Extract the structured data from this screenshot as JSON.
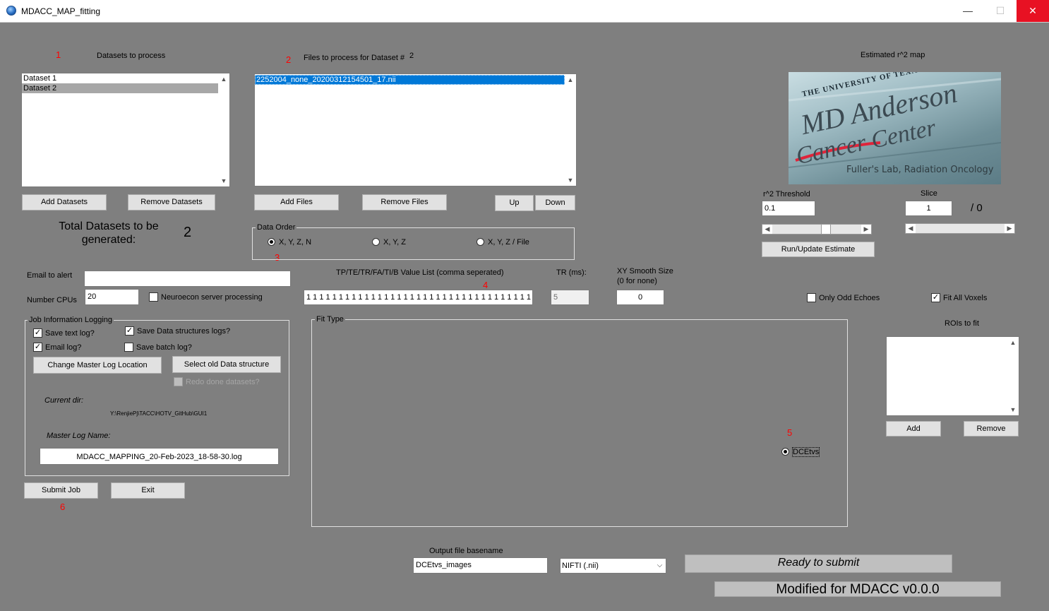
{
  "window": {
    "title": "MDACC_MAP_fitting",
    "minimize": "—",
    "maximize": "☐",
    "close": "✕"
  },
  "annotations": [
    "1",
    "2",
    "3",
    "4",
    "5",
    "6"
  ],
  "datasets": {
    "label": "Datasets to process",
    "items": [
      "Dataset  1",
      "Dataset  2"
    ],
    "add_button": "Add Datasets",
    "remove_button": "Remove Datasets",
    "total_label": "Total Datasets to be generated:",
    "total_value": "2"
  },
  "files": {
    "label": "Files to process for Dataset #",
    "dataset_number": "2",
    "items": [
      "2252004_none_20200312154501_17.nii"
    ],
    "add_button": "Add Files",
    "remove_button": "Remove Files",
    "up_button": "Up",
    "down_button": "Down"
  },
  "data_order": {
    "title": "Data Order",
    "options": [
      "X, Y, Z, N",
      "X, Y, Z",
      "X, Y, Z / File"
    ],
    "selected": "X, Y, Z, N"
  },
  "estimate": {
    "title": "Estimated r^2 map",
    "logo_line1": "THE UNIVERSITY OF TEXAS",
    "logo_line2": "MD Anderson",
    "logo_line3": "Cancer Center",
    "logo_caption": "Fuller's Lab, Radiation Oncology",
    "threshold_label": "r^2 Threshold",
    "threshold_value": "0.1",
    "slice_label": "Slice",
    "slice_value": "1",
    "slice_total": "/ 0",
    "run_button": "Run/Update Estimate",
    "threshold_slider_fraction": 0.62,
    "slice_slider_fraction": 0.0
  },
  "settings": {
    "email_label": "Email to alert",
    "email_value": "",
    "cpus_label": "Number CPUs",
    "cpus_value": "20",
    "neuroecon_label": "Neuroecon server processing",
    "neuroecon_checked": false,
    "value_list_label": "TP/TE/TR/FA/TI/B Value List (comma seperated)",
    "value_list_value": "1 1 1 1 1 1 1 1 1 1 1 1 1 1 1 1 1 1 1 1 1 1 1 1 1 1 1 1 1 1 1 1 1 1 1 1 1 1 1 1 1 1",
    "tr_label": "TR (ms):",
    "tr_value": "5",
    "smooth_label_1": "XY Smooth Size",
    "smooth_label_2": "(0 for none)",
    "smooth_value": "0",
    "odd_echoes_label": "Only Odd Echoes",
    "odd_echoes_checked": false,
    "fit_all_label": "Fit All Voxels",
    "fit_all_checked": true
  },
  "logging": {
    "title": "Job Information Logging",
    "save_text_log": "Save text log?",
    "email_log": "Email log?",
    "save_data_logs": "Save Data structures logs?",
    "save_batch_log": "Save batch log?",
    "change_master_button": "Change Master Log Location",
    "select_old_button": "Select old Data structure",
    "redo_label": "Redo done datasets?",
    "current_dir_label": "Current dir:",
    "current_dir_value": "Y:\\RenjiePj\\TACC\\HOTV_GitHub\\GUI1",
    "master_log_label": "Master Log Name:",
    "master_log_value": "MDACC_MAPPING_20-Feb-2023_18-58-30.log",
    "checks": {
      "save_text": true,
      "email": true,
      "save_data": true,
      "save_batch": false,
      "redo": false
    }
  },
  "fit_type": {
    "title": "Fit Type",
    "options": [
      "DCEtvs"
    ],
    "selected": "DCEtvs"
  },
  "rois": {
    "label": "ROIs to fit",
    "items": [],
    "add_button": "Add",
    "remove_button": "Remove"
  },
  "actions": {
    "submit_button": "Submit Job",
    "exit_button": "Exit"
  },
  "output": {
    "basename_label": "Output file basename",
    "basename_value": "DCEtvs_images",
    "format_value": "NIFTI (.nii)",
    "status_text": "Ready to submit",
    "version_text": "Modified for MDACC v0.0.0"
  }
}
